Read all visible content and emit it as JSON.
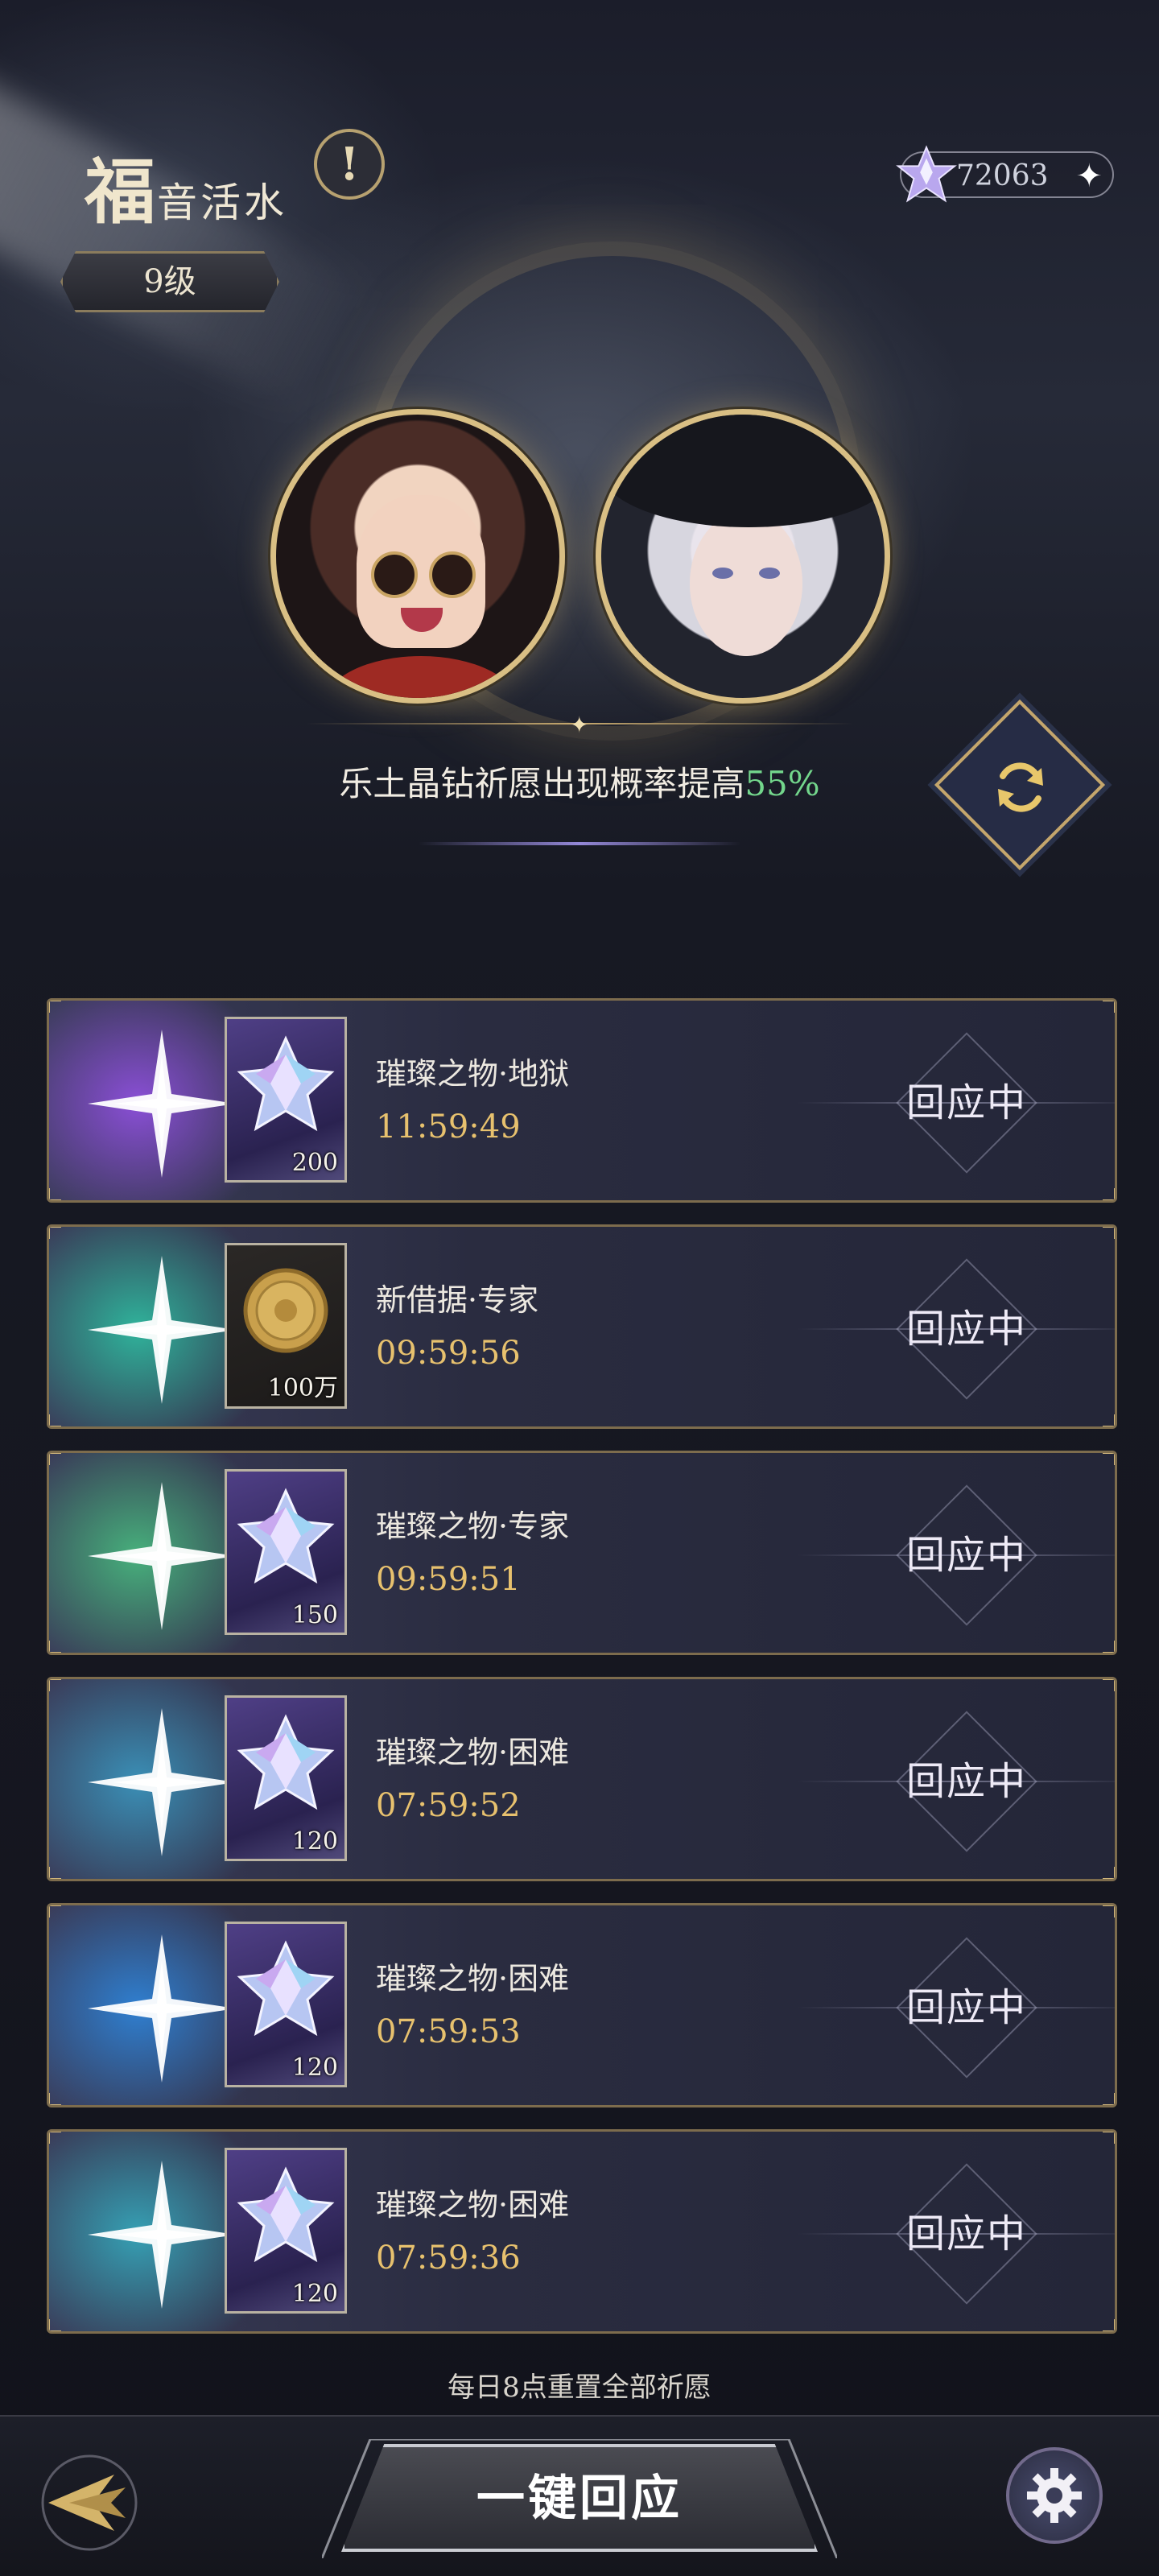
{
  "header": {
    "title_first_char": "福",
    "title_rest": "音活水",
    "info_icon": "exclamation-icon",
    "level": "9级",
    "currency": {
      "icon": "crystal-gem-icon",
      "value": "72063",
      "plus_icon": "sparkle-plus-icon"
    }
  },
  "boost": {
    "text": "乐土晶钻祈愿出现概率提高",
    "percent": "55%",
    "percent_color": "#73d68c",
    "refresh_icon": "refresh-icon"
  },
  "wishes": [
    {
      "name": "璀璨之物·地狱",
      "timer": "11:59:49",
      "quantity": "200",
      "item": "crystal",
      "status": "回应中",
      "glow": "#8a4fd6"
    },
    {
      "name": "新借据·专家",
      "timer": "09:59:56",
      "quantity": "100万",
      "item": "coin",
      "status": "回应中",
      "glow": "#2fb39b"
    },
    {
      "name": "璀璨之物·专家",
      "timer": "09:59:51",
      "quantity": "150",
      "item": "crystal",
      "status": "回应中",
      "glow": "#47b07c"
    },
    {
      "name": "璀璨之物·困难",
      "timer": "07:59:52",
      "quantity": "120",
      "item": "crystal",
      "status": "回应中",
      "glow": "#3a8fb6"
    },
    {
      "name": "璀璨之物·困难",
      "timer": "07:59:53",
      "quantity": "120",
      "item": "crystal",
      "status": "回应中",
      "glow": "#2f7fd0"
    },
    {
      "name": "璀璨之物·困难",
      "timer": "07:59:36",
      "quantity": "120",
      "item": "crystal",
      "status": "回应中",
      "glow": "#36a0b4"
    }
  ],
  "footer": {
    "reset_note": "每日8点重置全部祈愿",
    "main_button": "一键回应",
    "back_icon": "back-arrow-icon",
    "settings_icon": "gear-icon"
  },
  "colors": {
    "accent_gold": "#d9bf84",
    "timer": "#e7c16e"
  }
}
